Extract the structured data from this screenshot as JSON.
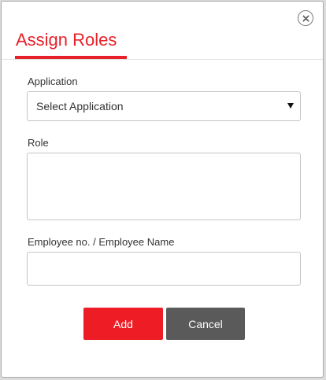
{
  "dialog": {
    "title": "Assign Roles",
    "close_icon": "close-icon"
  },
  "form": {
    "application": {
      "label": "Application",
      "selected": "Select Application"
    },
    "role": {
      "label": "Role",
      "value": ""
    },
    "employee": {
      "label": "Employee no. / Employee Name",
      "value": "",
      "placeholder": ""
    }
  },
  "actions": {
    "add_label": "Add",
    "cancel_label": "Cancel"
  },
  "colors": {
    "accent": "#e8202a",
    "add_button": "#ee1c25",
    "cancel_button": "#5a5a5a"
  }
}
